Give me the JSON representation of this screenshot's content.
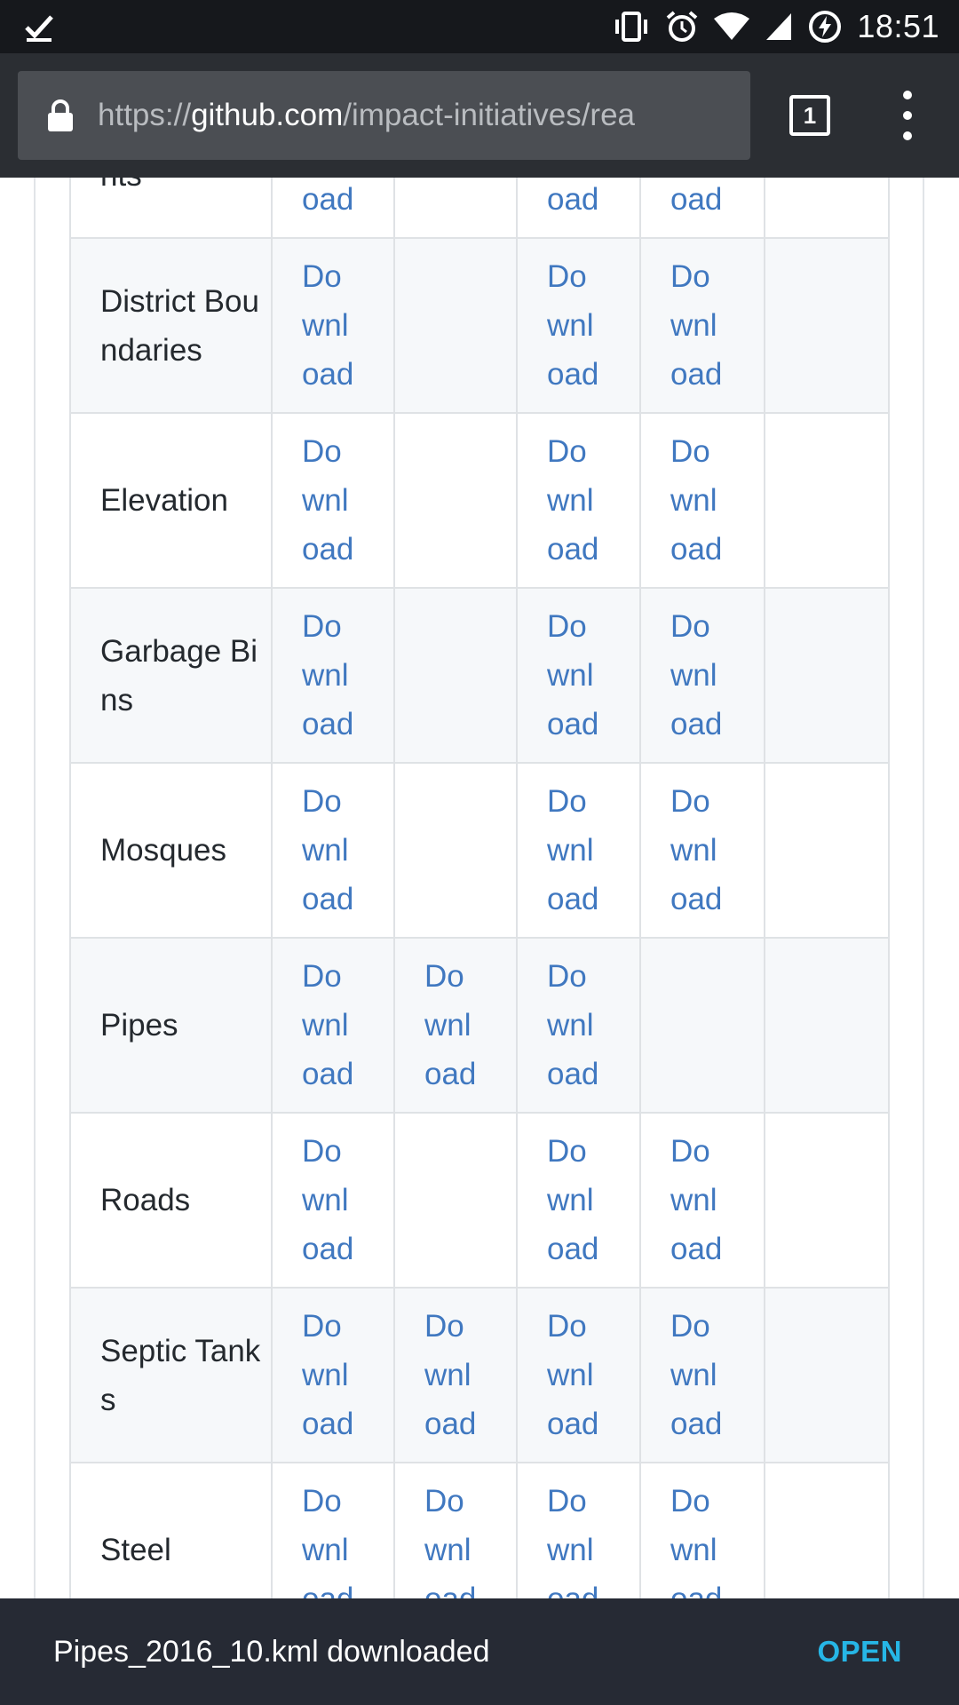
{
  "status_bar": {
    "time": "18:51",
    "icons": [
      "checkmark-icon",
      "vibrate-icon",
      "alarm-icon",
      "wifi-icon",
      "cell-signal-icon",
      "battery-charging-icon"
    ]
  },
  "browser": {
    "url_scheme": "https://",
    "url_host": "github.com",
    "url_path": "/impact-initiatives/rea",
    "tab_count": "1"
  },
  "table": {
    "link_text": "Download",
    "rows": [
      {
        "name": "Control Points",
        "links": [
          true,
          false,
          true,
          true,
          false
        ]
      },
      {
        "name": "District Boundaries",
        "links": [
          true,
          false,
          true,
          true,
          false
        ]
      },
      {
        "name": "Elevation",
        "links": [
          true,
          false,
          true,
          true,
          false
        ]
      },
      {
        "name": "Garbage Bins",
        "links": [
          true,
          false,
          true,
          true,
          false
        ]
      },
      {
        "name": "Mosques",
        "links": [
          true,
          false,
          true,
          true,
          false
        ]
      },
      {
        "name": "Pipes",
        "links": [
          true,
          true,
          true,
          false,
          false
        ]
      },
      {
        "name": "Roads",
        "links": [
          true,
          false,
          true,
          true,
          false
        ]
      },
      {
        "name": "Septic Tanks",
        "links": [
          true,
          true,
          true,
          true,
          false
        ]
      },
      {
        "name": "Steel",
        "links": [
          true,
          true,
          true,
          true,
          false
        ]
      }
    ]
  },
  "snackbar": {
    "message": "Pipes_2016_10.kml downloaded",
    "action": "OPEN"
  },
  "colors": {
    "link": "#4078c0",
    "snackbar_action": "#26b6e6",
    "toolbar": "#2b2e33",
    "status_bar": "#16181c"
  }
}
